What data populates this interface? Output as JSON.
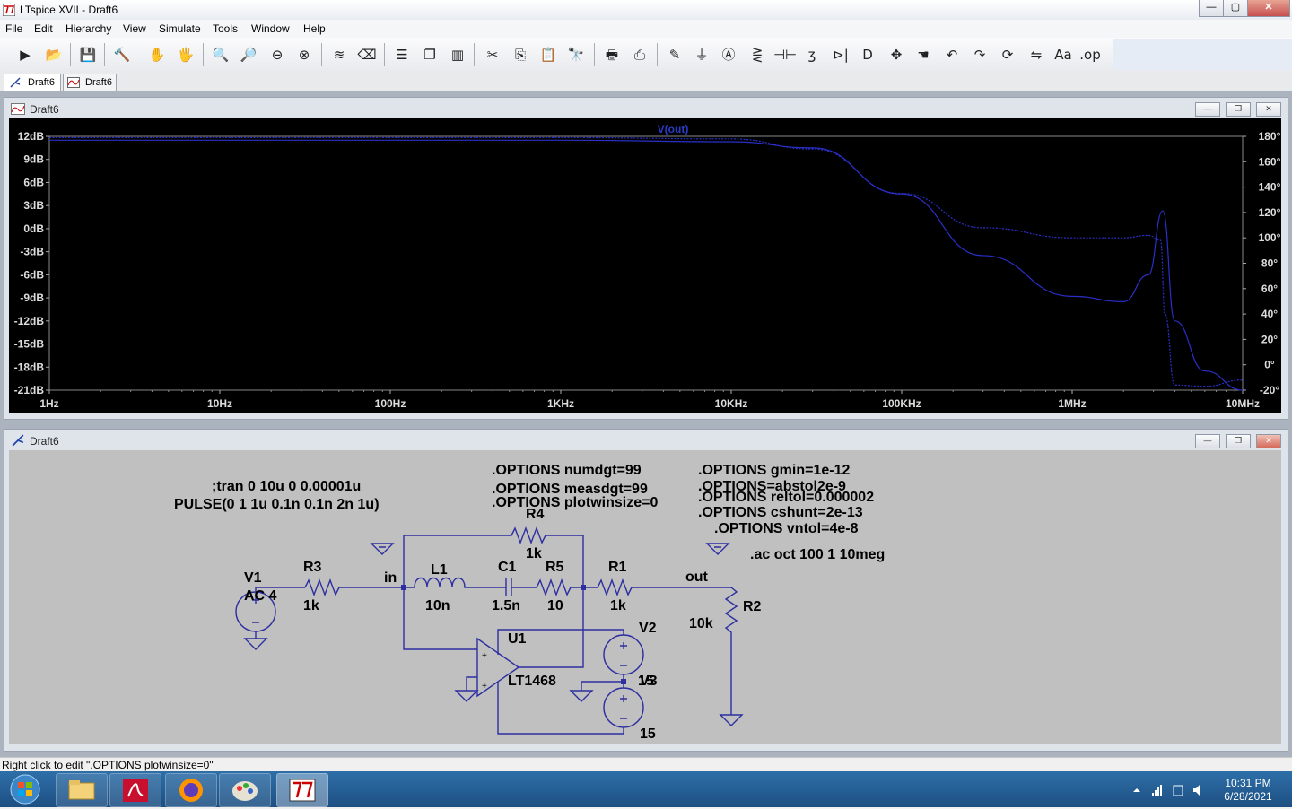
{
  "window": {
    "title": "LTspice XVII - Draft6",
    "buttons": {
      "min": "—",
      "max": "▢",
      "close": "✕"
    }
  },
  "menu": [
    "File",
    "Edit",
    "Hierarchy",
    "View",
    "Simulate",
    "Tools",
    "Window",
    "Help"
  ],
  "toolbar": [
    "run-icon",
    "open-icon",
    "save-icon",
    "control-panel-icon",
    "halt-icon",
    "pan-icon",
    "zoom-in-icon",
    "zoom-fit-icon",
    "zoom-out-icon",
    "zoom-cancel-icon",
    "autorange-icon",
    "delete-trace-icon",
    "tile-horizontal-icon",
    "cascade-icon",
    "tile-vertical-icon",
    "cut-icon",
    "copy-icon",
    "paste-icon",
    "find-icon",
    "print-icon",
    "print-setup-icon",
    "draw-wire-icon",
    "ground-icon",
    "label-net-icon",
    "resistor-icon",
    "capacitor-icon",
    "inductor-icon",
    "diode-icon",
    "component-icon",
    "move-icon",
    "drag-icon",
    "undo-icon",
    "redo-icon",
    "rotate-icon",
    "mirror-icon",
    "text-icon",
    "spice-directive-icon"
  ],
  "tabs": [
    {
      "label": "Draft6"
    },
    {
      "label": "Draft6"
    }
  ],
  "plot_window": {
    "title": "Draft6",
    "trace": "V(out)"
  },
  "schematic_window": {
    "title": "Draft6"
  },
  "chart_data": {
    "type": "line",
    "title": "",
    "xscale": "log",
    "xlim": [
      1,
      10000000
    ],
    "x_ticks": [
      "1Hz",
      "10Hz",
      "100Hz",
      "1KHz",
      "10KHz",
      "100KHz",
      "1MHz",
      "10MHz"
    ],
    "ylim": [
      -21,
      12
    ],
    "y_ticks": [
      "12dB",
      "9dB",
      "6dB",
      "3dB",
      "0dB",
      "-3dB",
      "-6dB",
      "-9dB",
      "-12dB",
      "-15dB",
      "-18dB",
      "-21dB"
    ],
    "y2lim": [
      -20,
      180
    ],
    "y2_ticks": [
      "180°",
      "160°",
      "140°",
      "120°",
      "100°",
      "80°",
      "60°",
      "40°",
      "20°",
      "0°",
      "-20°"
    ],
    "grid": false,
    "series": [
      {
        "name": "V(out)",
        "axis": "left",
        "x": [
          1,
          10,
          100,
          1000,
          10000,
          30000,
          100000,
          300000,
          1000000,
          2000000,
          2800000,
          3400000,
          4000000,
          6000000,
          10000000
        ],
        "values": [
          11.5,
          11.5,
          11.5,
          11.5,
          11.3,
          10.5,
          4.5,
          -3.5,
          -8.8,
          -9.5,
          -6.0,
          2.3,
          -12.0,
          -18.5,
          -21.0
        ]
      },
      {
        "name": "",
        "axis": "right",
        "x": [
          1,
          10,
          100,
          1000,
          10000,
          30000,
          100000,
          300000,
          1000000,
          2000000,
          2800000,
          3300000,
          3500000,
          4000000,
          6000000,
          10000000
        ],
        "values": [
          179,
          179,
          179,
          179,
          178,
          170,
          135,
          108,
          100,
          100,
          102,
          98,
          40,
          -16,
          -17,
          -12
        ]
      }
    ]
  },
  "schematic": {
    "directives": {
      "numdgt": ".OPTIONS numdgt=99",
      "measdgt": ".OPTIONS measdgt=99",
      "plotwinsize": ".OPTIONS plotwinsize=0",
      "gmin": ".OPTIONS gmin=1e-12",
      "abstol": ".OPTIONS=abstol2e-9",
      "reltol": ".OPTIONS reltol=0.000002",
      "cshunt": ".OPTIONS cshunt=2e-13",
      "vntol": ".OPTIONS vntol=4e-8",
      "ac": ".ac oct 100 1 10meg",
      "tran": ";tran 0 10u 0 0.00001u",
      "pulse": "PULSE(0 1 1u 0.1n 0.1n 2n 1u)"
    },
    "labels": {
      "V1": "V1",
      "V1val": "AC 4",
      "R3": "R3",
      "R3val": "1k",
      "in": "in",
      "L1": "L1",
      "L1val": "10n",
      "C1": "C1",
      "C1val": "1.5n",
      "R5": "R5",
      "R5val": "10",
      "R4": "R4",
      "R4val": "1k",
      "R1": "R1",
      "R1val": "1k",
      "out": "out",
      "R2": "R2",
      "R2val": "10k",
      "U1": "U1",
      "U1val": "LT1468",
      "V2": "V2",
      "V3": "V3",
      "V2val": "15",
      "V3val": "15"
    }
  },
  "status": "Right click to edit \".OPTIONS plotwinsize=0\"",
  "taskbar": {
    "apps": [
      "start-orb-icon",
      "file-explorer-icon",
      "acrobat-icon",
      "firefox-icon",
      "paint-icon",
      "ltspice-icon"
    ],
    "time": "10:31 PM",
    "date": "6/28/2021",
    "tray": [
      "show-hidden-icon",
      "signal-icon",
      "network-icon",
      "volume-icon"
    ]
  }
}
